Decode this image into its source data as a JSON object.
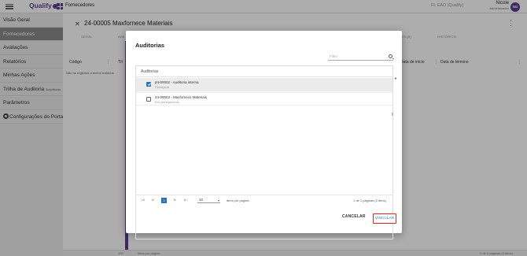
{
  "app": {
    "logo": "Qualify",
    "module": "Fornecedores",
    "tenant": "FL EAD (Qualify)",
    "user_name": "Nicole",
    "user_role": "Administrador",
    "user_initials": "NG"
  },
  "sidebar": {
    "items": [
      {
        "label": "Visão Geral"
      },
      {
        "label": "Fornecedores"
      },
      {
        "label": "Avaliações"
      },
      {
        "label": "Relatórios"
      },
      {
        "label": "Minhas Ações"
      },
      {
        "label": "Trilha de Auditoria",
        "tag": "Simplificada"
      },
      {
        "label": "Parâmetros"
      },
      {
        "label": "Configurações do Portal"
      }
    ]
  },
  "record": {
    "title": "24-00005 Maxfornece Materiais",
    "tabs": [
      "GERAL",
      "AVA",
      "ÕES (0)",
      "HISTÓRICO"
    ]
  },
  "list": {
    "columns": [
      "Código",
      "Tít",
      "Data de início",
      "Data de término"
    ],
    "empty_message": "Não há registros a serem exibidos",
    "per_page": "100",
    "per_page_label": "itens por página",
    "range": "0 de 0 páginas (0 itens)"
  },
  "modal": {
    "title": "Auditorias",
    "filter_placeholder": "Filtro",
    "panel_label": "Auditorias",
    "items": [
      {
        "title": "24-00002 - Auditoria interna",
        "status": "Planejada",
        "checked": true
      },
      {
        "title": "24-00003 - Maxfornece Materiais",
        "status": "Em planejamento",
        "checked": false
      }
    ],
    "pagination": {
      "current_page": "1",
      "page_size": "10",
      "page_size_label": "itens por página",
      "info": "1 de 1 páginas (2 itens)"
    },
    "cancel_label": "CANCELAR",
    "link_label": "VINCULAR"
  },
  "colors": {
    "brand": "#5b3f92",
    "primary": "#2e6fbd",
    "highlight": "#d62828"
  }
}
